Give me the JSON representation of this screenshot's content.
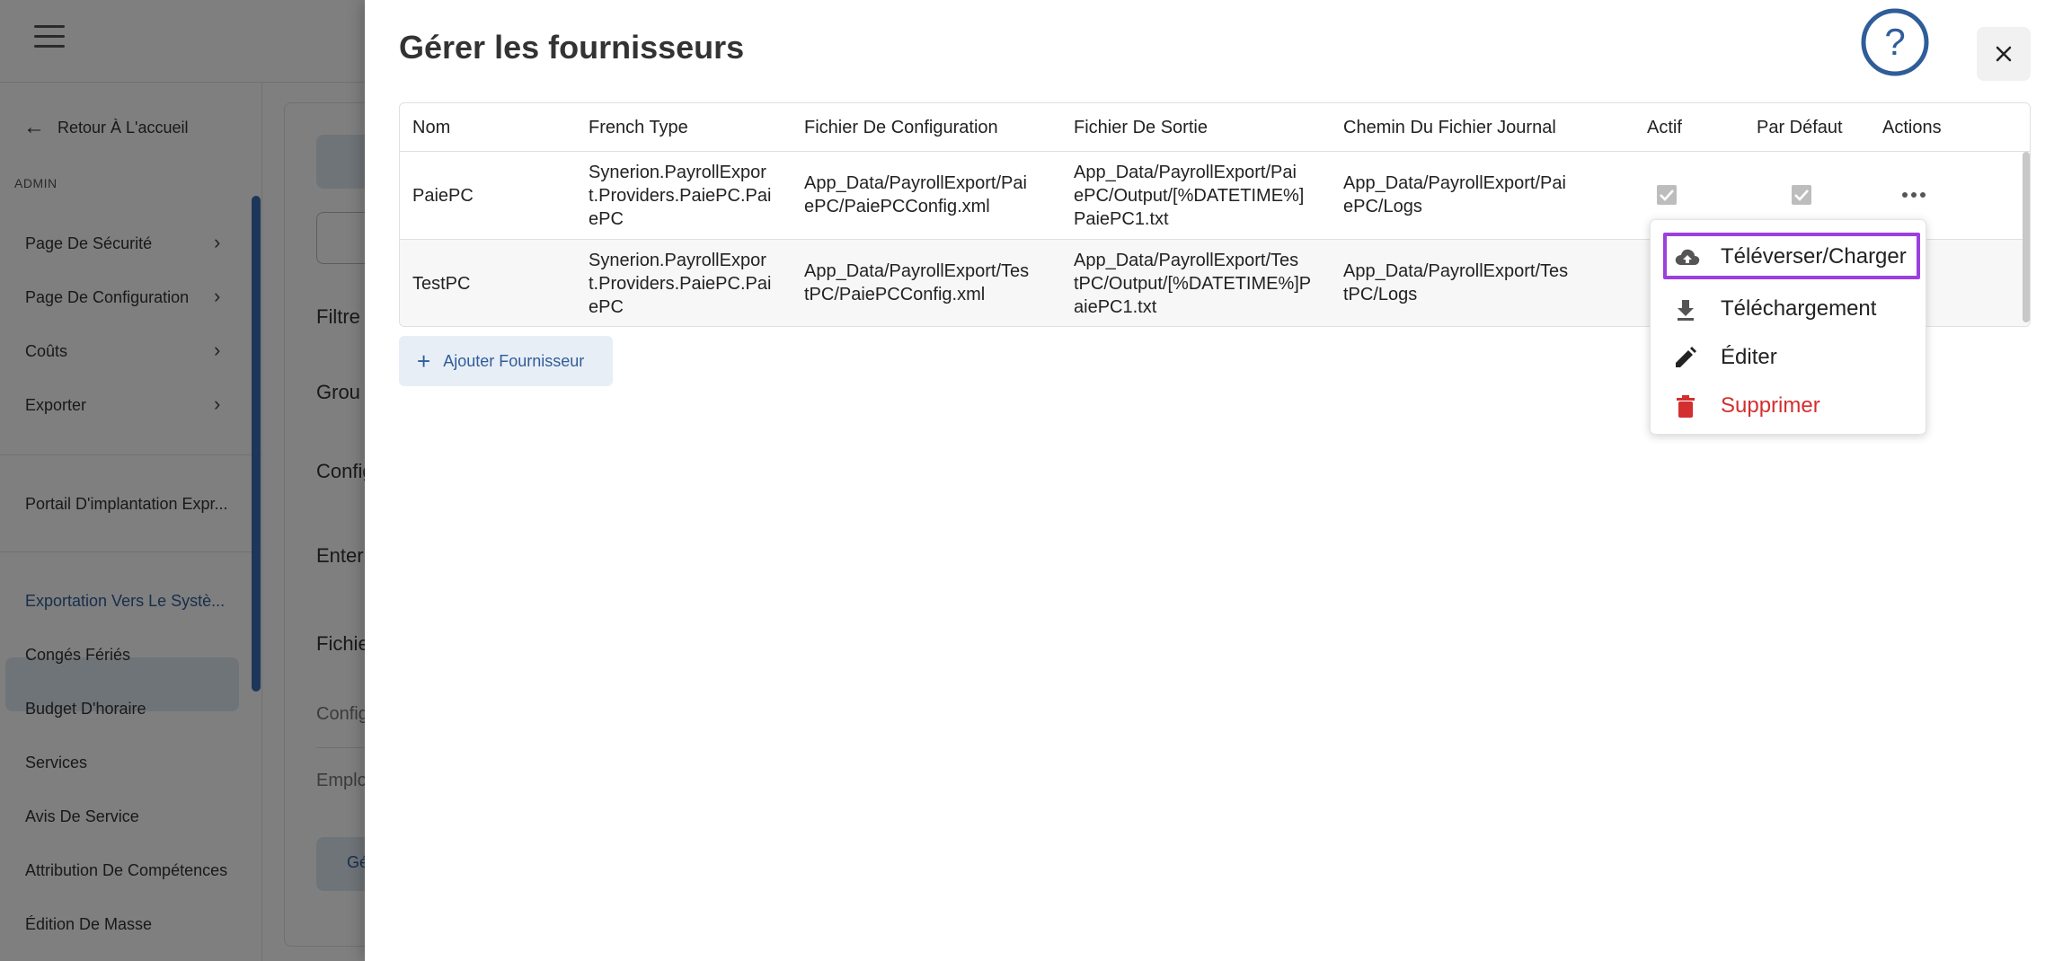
{
  "background": {
    "sidebar": {
      "back_label": "Retour À L'accueil",
      "section_label": "ADMIN",
      "items": [
        {
          "label": "Page De Sécurité",
          "has_chevron": true
        },
        {
          "label": "Page De Configuration",
          "has_chevron": true
        },
        {
          "label": "Coûts",
          "has_chevron": true
        },
        {
          "label": "Exporter",
          "has_chevron": true
        },
        {
          "label": "Portail D'implantation Expr..."
        },
        {
          "label": "Exportation Vers Le Systè...",
          "active": true
        },
        {
          "label": "Congés Fériés"
        },
        {
          "label": "Budget D'horaire"
        },
        {
          "label": "Services"
        },
        {
          "label": "Avis De Service"
        },
        {
          "label": "Attribution De Compétences"
        },
        {
          "label": "Édition De Masse"
        }
      ]
    },
    "content": {
      "labels": [
        "Filtre",
        "Grou",
        "Config",
        "Enter",
        "Fichie"
      ],
      "sublabels": [
        "Config",
        "Emplo"
      ],
      "bottom_button": "Gé"
    }
  },
  "drawer": {
    "title": "Gérer les fournisseurs",
    "columns": [
      "Nom",
      "French Type",
      "Fichier De Configuration",
      "Fichier De Sortie",
      "Chemin Du Fichier Journal",
      "Actif",
      "Par Défaut",
      "Actions"
    ],
    "rows": [
      {
        "name": "PaiePC",
        "type": [
          "Synerion.PayrollExpor",
          "t.Providers.PaiePC.Pai",
          "ePC"
        ],
        "config": [
          "App_Data/PayrollExport/Pai",
          "ePC/PaiePCConfig.xml"
        ],
        "output": [
          "App_Data/PayrollExport/Pai",
          "ePC/Output/[%DATETIME%]",
          "PaiePC1.txt"
        ],
        "log": [
          "App_Data/PayrollExport/Pai",
          "ePC/Logs"
        ],
        "active": true,
        "default": true
      },
      {
        "name": "TestPC",
        "type": [
          "Synerion.PayrollExpor",
          "t.Providers.PaiePC.Pai",
          "ePC"
        ],
        "config": [
          "App_Data/PayrollExport/Tes",
          "tPC/PaiePCConfig.xml"
        ],
        "output": [
          "App_Data/PayrollExport/Tes",
          "tPC/Output/[%DATETIME%]P",
          "aiePC1.txt"
        ],
        "log": [
          "App_Data/PayrollExport/Tes",
          "tPC/Logs"
        ]
      }
    ],
    "add_button_label": "Ajouter Fournisseur",
    "menu": {
      "items": [
        {
          "label": "Téléverser/Charger",
          "icon": "cloud-upload-icon",
          "highlighted": true
        },
        {
          "label": "Téléchargement",
          "icon": "download-icon"
        },
        {
          "label": "Éditer",
          "icon": "pencil-icon"
        },
        {
          "label": "Supprimer",
          "icon": "trash-icon",
          "danger": true
        }
      ]
    },
    "colors": {
      "accent": "#2f5d99",
      "highlight": "#9b3fe0",
      "danger": "#d32f2f",
      "help": "#2f5d99"
    }
  }
}
